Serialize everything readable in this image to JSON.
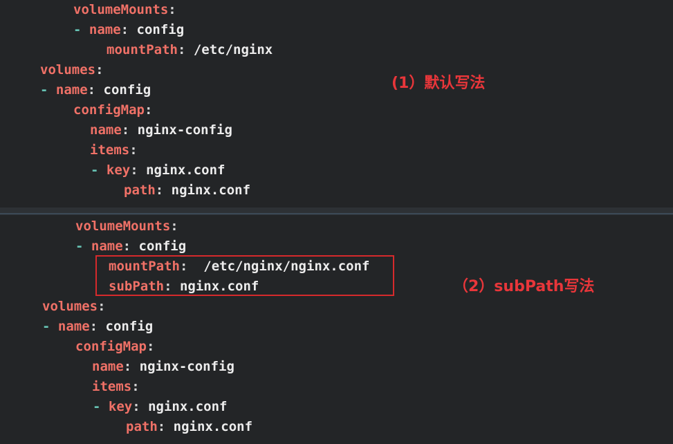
{
  "top": {
    "lines": [
      {
        "key": "volumeMounts",
        "sep": ":",
        "dash": "",
        "value": ""
      },
      {
        "key": "name",
        "sep": ": ",
        "dash": "- ",
        "value": "config"
      },
      {
        "key": "mountPath",
        "sep": ": ",
        "dash": "",
        "value": "/etc/nginx"
      },
      {
        "key": "volumes",
        "sep": ":",
        "dash": "",
        "value": ""
      },
      {
        "key": "name",
        "sep": ": ",
        "dash": "- ",
        "value": "config"
      },
      {
        "key": "configMap",
        "sep": ":",
        "dash": "",
        "value": ""
      },
      {
        "key": "name",
        "sep": ": ",
        "dash": "",
        "value": "nginx-config"
      },
      {
        "key": "items",
        "sep": ":",
        "dash": "",
        "value": ""
      },
      {
        "key": "key",
        "sep": ": ",
        "dash": "- ",
        "value": "nginx.conf"
      },
      {
        "key": "path",
        "sep": ": ",
        "dash": "",
        "value": "nginx.conf"
      }
    ],
    "annotation": "(1）默认写法"
  },
  "bottom": {
    "lines": [
      {
        "key": "volumeMounts",
        "sep": ":",
        "dash": "",
        "value": ""
      },
      {
        "key": "name",
        "sep": ": ",
        "dash": "- ",
        "value": "config"
      },
      {
        "key": "mountPath",
        "sep": ":  ",
        "dash": "",
        "value": "/etc/nginx/nginx.conf"
      },
      {
        "key": "subPath",
        "sep": ": ",
        "dash": "",
        "value": "nginx.conf"
      },
      {
        "key": "volumes",
        "sep": ":",
        "dash": "",
        "value": ""
      },
      {
        "key": "name",
        "sep": ": ",
        "dash": "- ",
        "value": "config"
      },
      {
        "key": "configMap",
        "sep": ":",
        "dash": "",
        "value": ""
      },
      {
        "key": "name",
        "sep": ": ",
        "dash": "",
        "value": "nginx-config"
      },
      {
        "key": "items",
        "sep": ":",
        "dash": "",
        "value": ""
      },
      {
        "key": "key",
        "sep": ": ",
        "dash": "- ",
        "value": "nginx.conf"
      },
      {
        "key": "path",
        "sep": ": ",
        "dash": "",
        "value": "nginx.conf"
      }
    ],
    "annotation": "（2）subPath写法"
  },
  "colors": {
    "key": "#f07167",
    "value": "#ececec",
    "dash": "#66c2b3",
    "annotation": "#e8363a",
    "background": "#232527"
  }
}
